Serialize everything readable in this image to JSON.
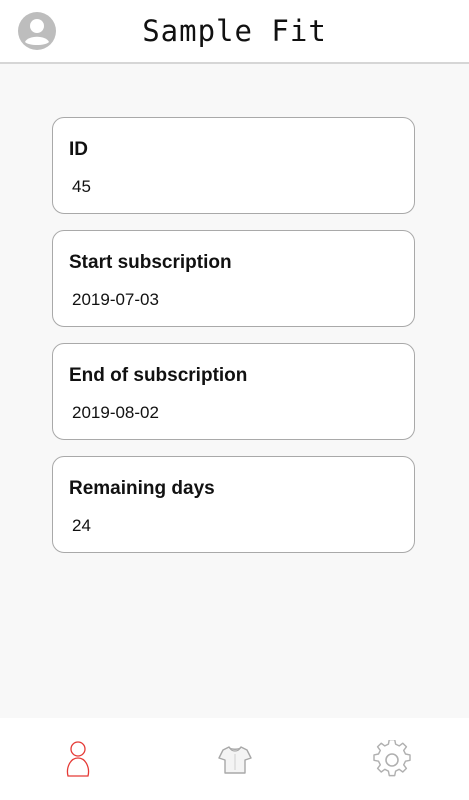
{
  "header": {
    "title": "Sample Fit",
    "avatar_icon": "account-circle-icon"
  },
  "cards": [
    {
      "label": "ID",
      "value": "45"
    },
    {
      "label": "Start subscription",
      "value": "2019-07-03"
    },
    {
      "label": "End of subscription",
      "value": "2019-08-02"
    },
    {
      "label": "Remaining days",
      "value": "24"
    }
  ],
  "bottom_nav": {
    "items": [
      {
        "icon": "person-icon",
        "active": true
      },
      {
        "icon": "tshirt-icon",
        "active": false
      },
      {
        "icon": "gear-icon",
        "active": false
      }
    ],
    "active_color": "#e53935",
    "inactive_color": "#b5b5b5"
  }
}
